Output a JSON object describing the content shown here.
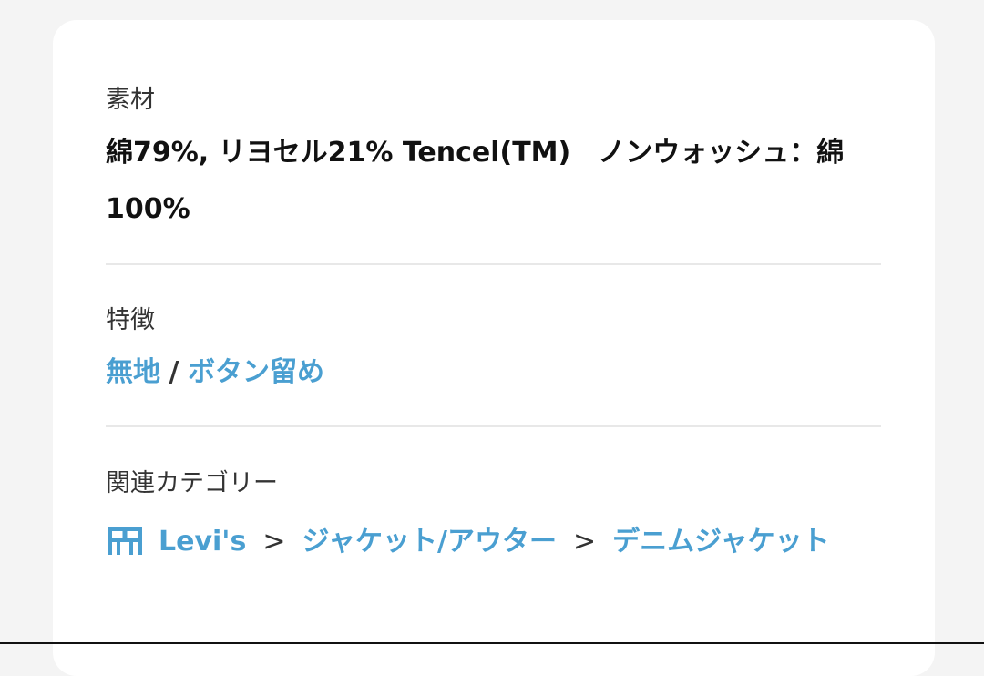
{
  "material": {
    "label": "素材",
    "value": "綿79%, リヨセル21% Tencel(TM)　ノンウォッシュ：綿100%"
  },
  "features": {
    "label": "特徴",
    "items": [
      "無地",
      "ボタン留め"
    ],
    "separator": "/"
  },
  "categories": {
    "label": "関連カテゴリー",
    "icon": "store-icon",
    "crumbs": [
      "Levi's",
      "ジャケット/アウター",
      "デニムジャケット"
    ],
    "chevron": ">"
  },
  "colors": {
    "link": "#4a9fd1",
    "text": "#111111",
    "label": "#333333",
    "divider": "#e8e8e8",
    "card": "#ffffff",
    "background": "#f4f4f4"
  }
}
